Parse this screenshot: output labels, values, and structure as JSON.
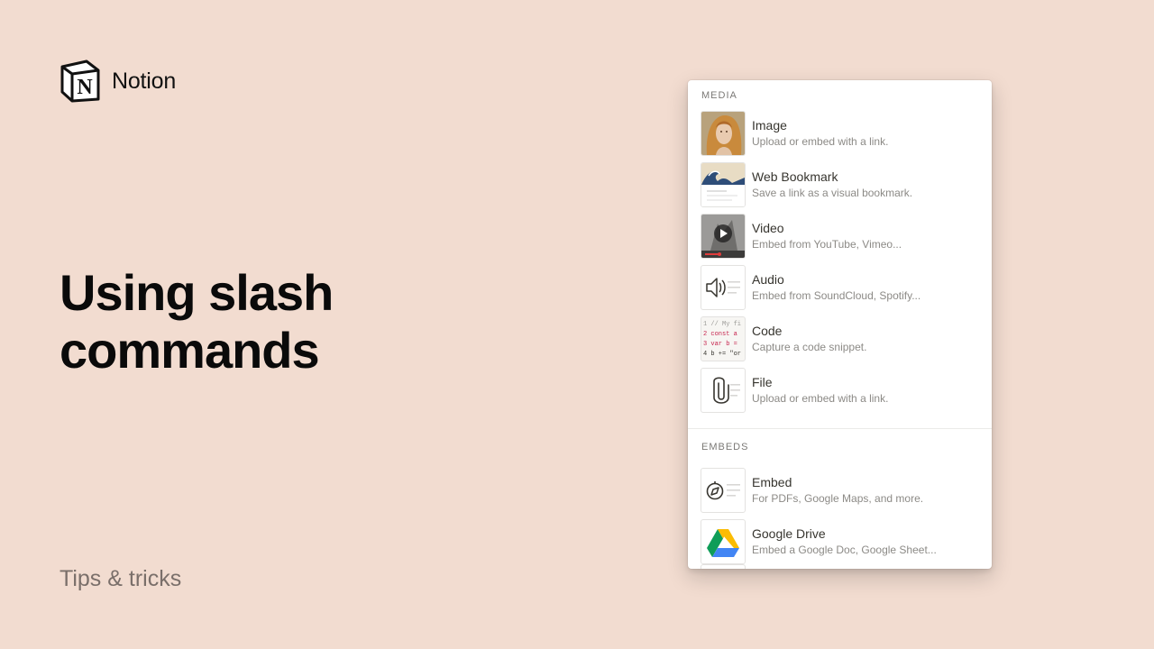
{
  "brand": {
    "name": "Notion",
    "logo_icon": "notion-logo-icon"
  },
  "headline": {
    "line1": "Using slash",
    "line2": "commands"
  },
  "footer": {
    "tag": "Tips & tricks"
  },
  "menu": {
    "media_label": "MEDIA",
    "media_items": [
      {
        "title": "Image",
        "desc": "Upload or embed with a link.",
        "icon": "image-thumbnail-icon"
      },
      {
        "title": "Web Bookmark",
        "desc": "Save a link as a visual bookmark.",
        "icon": "bookmark-thumbnail-icon"
      },
      {
        "title": "Video",
        "desc": "Embed from YouTube, Vimeo...",
        "icon": "video-thumbnail-icon"
      },
      {
        "title": "Audio",
        "desc": "Embed from SoundCloud, Spotify...",
        "icon": "audio-icon"
      },
      {
        "title": "Code",
        "desc": "Capture a code snippet.",
        "icon": "code-icon"
      },
      {
        "title": "File",
        "desc": "Upload or embed with a link.",
        "icon": "paperclip-icon"
      }
    ],
    "code_lines": [
      "1 // My fi",
      "2 const a",
      "3 var b =",
      "4 b += \"or"
    ],
    "embeds_label": "EMBEDS",
    "embed_items": [
      {
        "title": "Embed",
        "desc": "For PDFs, Google Maps, and more.",
        "icon": "compass-icon"
      },
      {
        "title": "Google Drive",
        "desc": "Embed a Google Doc, Google Sheet...",
        "icon": "google-drive-icon"
      }
    ]
  }
}
